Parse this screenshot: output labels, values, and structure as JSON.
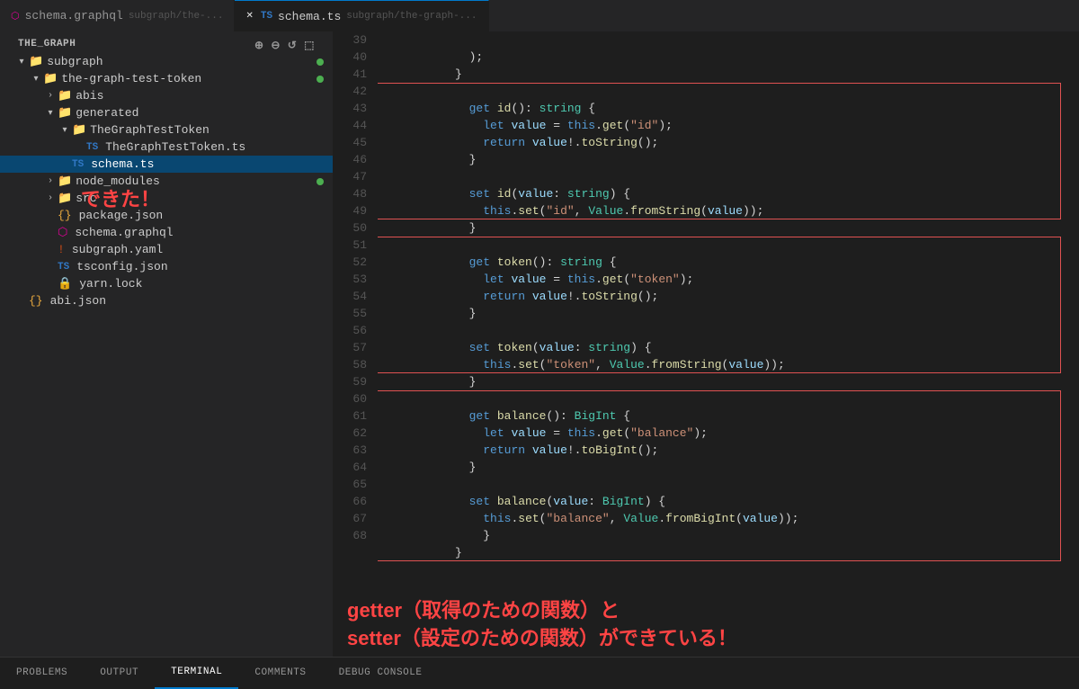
{
  "tabs": [
    {
      "id": "schema-graphql",
      "label": "schema.graphql",
      "path": "subgraph/the-...",
      "icon": "graphql",
      "active": false,
      "closeable": false
    },
    {
      "id": "schema-ts",
      "label": "schema.ts",
      "path": "subgraph/the-graph-...",
      "icon": "ts",
      "active": true,
      "closeable": true
    }
  ],
  "sidebar": {
    "section_title": "THE_GRAPH",
    "tree": [
      {
        "id": "subgraph",
        "label": "subgraph",
        "indent": 0,
        "type": "folder",
        "open": true,
        "dot": true
      },
      {
        "id": "the-graph-test-token",
        "label": "the-graph-test-token",
        "indent": 1,
        "type": "folder",
        "open": true,
        "dot": true
      },
      {
        "id": "abis",
        "label": "abis",
        "indent": 2,
        "type": "folder",
        "open": false
      },
      {
        "id": "generated",
        "label": "generated",
        "indent": 2,
        "type": "folder",
        "open": true
      },
      {
        "id": "TheGraphTestToken",
        "label": "TheGraphTestToken",
        "indent": 3,
        "type": "folder",
        "open": true
      },
      {
        "id": "TheGraphTestToken.ts",
        "label": "TheGraphTestToken.ts",
        "indent": 4,
        "type": "ts-file"
      },
      {
        "id": "schema.ts",
        "label": "schema.ts",
        "indent": 3,
        "type": "ts-file",
        "selected": true
      },
      {
        "id": "node_modules",
        "label": "node_modules",
        "indent": 2,
        "type": "folder",
        "open": false,
        "dot": true
      },
      {
        "id": "src",
        "label": "src",
        "indent": 2,
        "type": "folder",
        "open": false
      },
      {
        "id": "package.json",
        "label": "package.json",
        "indent": 2,
        "type": "json-file"
      },
      {
        "id": "schema.graphql",
        "label": "schema.graphql",
        "indent": 2,
        "type": "graphql-file"
      },
      {
        "id": "subgraph.yaml",
        "label": "subgraph.yaml",
        "indent": 2,
        "type": "yaml-file"
      },
      {
        "id": "tsconfig.json",
        "label": "tsconfig.json",
        "indent": 2,
        "type": "ts-config"
      },
      {
        "id": "yarn.lock",
        "label": "yarn.lock",
        "indent": 2,
        "type": "yarn-file"
      },
      {
        "id": "abi.json",
        "label": "abi.json",
        "indent": 0,
        "type": "json-file"
      }
    ],
    "annotation": "できた！"
  },
  "code": {
    "lines": [
      {
        "num": 39,
        "content": "  );"
      },
      {
        "num": 40,
        "content": "}"
      },
      {
        "num": 41,
        "content": ""
      },
      {
        "num": 42,
        "content": "  get id(): string {"
      },
      {
        "num": 43,
        "content": "    let value = this.get(\"id\");"
      },
      {
        "num": 44,
        "content": "    return value!.toString();"
      },
      {
        "num": 45,
        "content": "  }"
      },
      {
        "num": 46,
        "content": ""
      },
      {
        "num": 47,
        "content": "  set id(value: string) {"
      },
      {
        "num": 48,
        "content": "    this.set(\"id\", Value.fromString(value));"
      },
      {
        "num": 49,
        "content": "  }"
      },
      {
        "num": 50,
        "content": ""
      },
      {
        "num": 51,
        "content": "  get token(): string {"
      },
      {
        "num": 52,
        "content": "    let value = this.get(\"token\");"
      },
      {
        "num": 53,
        "content": "    return value!.toString();"
      },
      {
        "num": 54,
        "content": "  }"
      },
      {
        "num": 55,
        "content": ""
      },
      {
        "num": 56,
        "content": "  set token(value: string) {"
      },
      {
        "num": 57,
        "content": "    this.set(\"token\", Value.fromString(value));"
      },
      {
        "num": 58,
        "content": "  }"
      },
      {
        "num": 59,
        "content": ""
      },
      {
        "num": 60,
        "content": "  get balance(): BigInt {"
      },
      {
        "num": 61,
        "content": "    let value = this.get(\"balance\");"
      },
      {
        "num": 62,
        "content": "    return value!.toBigInt();"
      },
      {
        "num": 63,
        "content": "  }"
      },
      {
        "num": 64,
        "content": ""
      },
      {
        "num": 65,
        "content": "  set balance(value: BigInt) {"
      },
      {
        "num": 66,
        "content": "    this.set(\"balance\", Value.fromBigInt(value));"
      },
      {
        "num": 67,
        "content": "  }"
      },
      {
        "num": 68,
        "content": "}"
      }
    ]
  },
  "bottom_annotation": {
    "line1": "getter（取得のための関数）と",
    "line2": "setter（設定のための関数）ができている！"
  },
  "bottom_tabs": [
    {
      "id": "problems",
      "label": "PROBLEMS",
      "active": false
    },
    {
      "id": "output",
      "label": "OUTPUT",
      "active": false
    },
    {
      "id": "terminal",
      "label": "TERMINAL",
      "active": true
    },
    {
      "id": "comments",
      "label": "COMMENTS",
      "active": false
    },
    {
      "id": "debug-console",
      "label": "DEBUG CONSOLE",
      "active": false
    }
  ],
  "colors": {
    "accent": "#007acc",
    "red_annotation": "#ff4444",
    "red_box": "#e05252",
    "selected_bg": "#094771",
    "tab_active_border": "#007acc"
  }
}
